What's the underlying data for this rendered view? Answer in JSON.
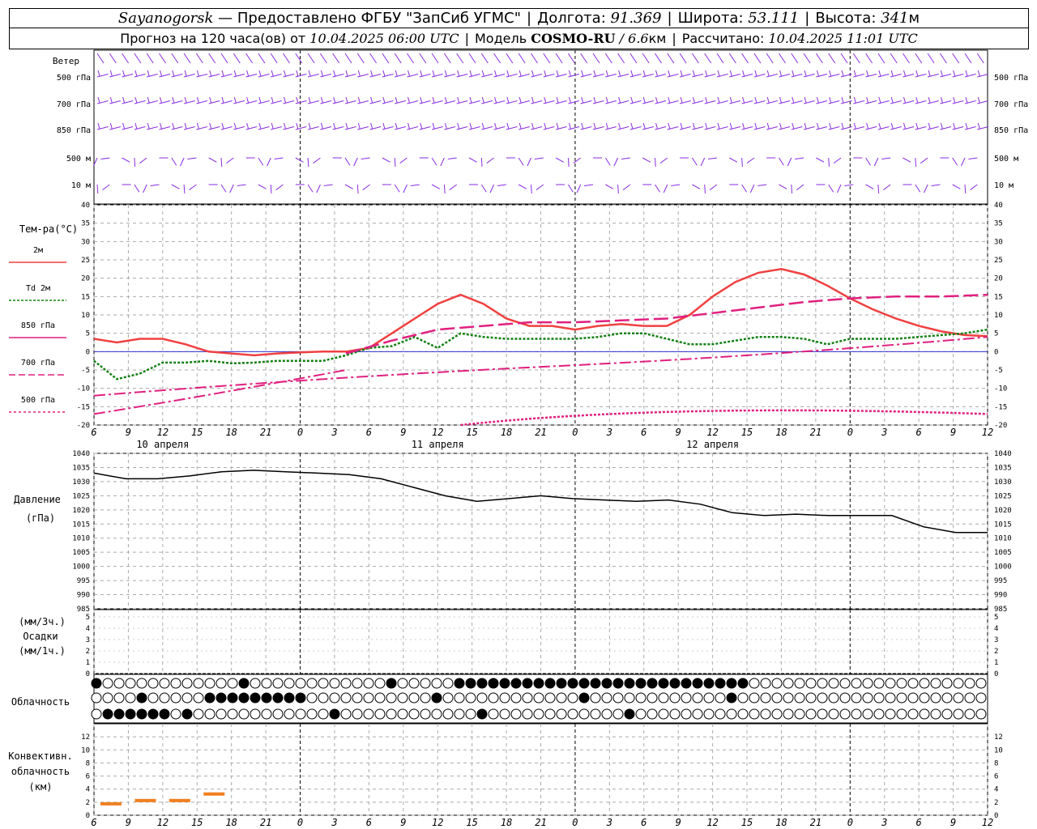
{
  "header": {
    "station": "Sayanogorsk",
    "provided_by": "— Предоставлено ФГБУ \"ЗапСиб УГМС\"",
    "lon_label": "Долгота:",
    "lon_value": "91.369",
    "lat_label": "Широта:",
    "lat_value": "53.111",
    "alt_label": "Высота:",
    "alt_value": "341",
    "alt_unit": "м",
    "forecast_prefix": "Прогноз на 120 часа(ов) от",
    "forecast_start": "10.04.2025 06:00 UTC",
    "model_label": "Модель",
    "model_name": "COSMO-RU",
    "model_res": "/ 6.6",
    "model_res_unit": "км",
    "computed_label": "Рассчитано:",
    "computed_time": "10.04.2025 11:01 UTC"
  },
  "wind_panel": {
    "title": "Ветер",
    "levels": [
      "500 гПа",
      "700 гПа",
      "850 гПа",
      "500 м",
      "10 м"
    ]
  },
  "temp_panel": {
    "title": "Тем-ра(°C)",
    "legend": [
      "2м",
      "Td 2м",
      "850 гПа",
      "700 гПа",
      "500 гПа"
    ],
    "y_ticks": [
      40,
      35,
      30,
      25,
      20,
      15,
      10,
      5,
      0,
      -5,
      -10,
      -15,
      -20
    ]
  },
  "time_axis": {
    "hour_labels": [
      "6",
      "9",
      "12",
      "15",
      "18",
      "21",
      "0",
      "3",
      "6",
      "9",
      "12",
      "15",
      "18",
      "21",
      "0",
      "3",
      "6",
      "9",
      "12",
      "15",
      "18",
      "21",
      "0",
      "3",
      "6",
      "9",
      "12"
    ],
    "dates": [
      "10 апреля",
      "11 апреля",
      "12 апреля"
    ]
  },
  "pressure_panel": {
    "title": "Давление",
    "unit": "(гПа)",
    "y_ticks": [
      1040,
      1035,
      1030,
      1025,
      1020,
      1015,
      1010,
      1005,
      1000,
      995,
      990,
      985
    ]
  },
  "precip_panel": {
    "unit_top": "(мм/3ч.)",
    "title": "Осадки",
    "unit_bottom": "(мм/1ч.)",
    "y_ticks": [
      5,
      4,
      3,
      2,
      1,
      0
    ]
  },
  "cloud_panel": {
    "title": "Облачность"
  },
  "conv_panel": {
    "title": [
      "Конвективн.",
      "облачность",
      "(км)"
    ],
    "y_ticks": [
      12,
      10,
      8,
      6,
      4,
      2,
      0
    ]
  },
  "colors": {
    "t2m": "#f04040",
    "td2m": "#138013",
    "t850": "#e0207f",
    "t700": "#e0207f",
    "t500": "#e0207f",
    "pressure": "#000000",
    "wind": "#8a2be2",
    "convective": "#f08020",
    "zero_line": "#3030d0"
  },
  "chart_data": {
    "type": "line",
    "x_hours_from_start": [
      0,
      3,
      6,
      9,
      12,
      15,
      18,
      21,
      24,
      27,
      30,
      33,
      36,
      39,
      42,
      45,
      48,
      51,
      54,
      57,
      60,
      63,
      66,
      69,
      72,
      75,
      78
    ],
    "xlim_hours": [
      0,
      78
    ],
    "series": [
      {
        "name": "2м",
        "units": "°C",
        "x": [
          0,
          2,
          4,
          6,
          8,
          10,
          12,
          14,
          16,
          18,
          20,
          22,
          24,
          26,
          28,
          30,
          32,
          34,
          36,
          38,
          40,
          42,
          44,
          46,
          48,
          50,
          52,
          54,
          56,
          58,
          60,
          62,
          64,
          66,
          68,
          70,
          72,
          74,
          76,
          78
        ],
        "y": [
          3.5,
          2.5,
          3.5,
          3.5,
          2,
          0,
          -0.5,
          -1,
          -0.5,
          -0.2,
          0,
          0,
          1,
          5,
          9,
          13,
          15.5,
          13,
          9,
          7,
          7,
          6,
          7,
          7.5,
          7,
          7,
          10,
          15,
          19,
          21.5,
          22.5,
          21,
          18,
          14.5,
          11.5,
          9,
          7,
          5.5,
          4.5,
          4.2
        ]
      },
      {
        "name": "Td 2м",
        "units": "°C",
        "x": [
          0,
          2,
          4,
          6,
          8,
          10,
          12,
          14,
          16,
          18,
          20,
          22,
          24,
          26,
          28,
          30,
          32,
          34,
          36,
          38,
          40,
          42,
          44,
          46,
          48,
          50,
          52,
          54,
          56,
          58,
          60,
          62,
          64,
          66,
          68,
          70,
          72,
          74,
          76,
          78
        ],
        "y": [
          -2.5,
          -7.5,
          -6,
          -3,
          -3,
          -2.5,
          -3.2,
          -3,
          -2.5,
          -2.5,
          -2.5,
          -1,
          1,
          1.5,
          4,
          1,
          5,
          4,
          3.5,
          3.5,
          3.5,
          3.5,
          4,
          5,
          5,
          3.5,
          2,
          2,
          3,
          4,
          4,
          3.5,
          2,
          3.5,
          3.5,
          3.5,
          4,
          4.5,
          5,
          6
        ]
      },
      {
        "name": "850 гПа",
        "units": "°C",
        "x": [
          22,
          26,
          30,
          34,
          38,
          42,
          46,
          50,
          54,
          58,
          62,
          66,
          70,
          74,
          78
        ],
        "y": [
          -0.5,
          3,
          6,
          7,
          8,
          8,
          8.5,
          9,
          10.5,
          12,
          13.5,
          14.5,
          15,
          15,
          15.5
        ]
      }
    ],
    "ylim_temp": [
      -20,
      40
    ],
    "pressure_hPa": {
      "x": [
        0,
        3,
        6,
        9,
        12,
        15,
        18,
        21,
        24,
        27,
        30,
        33,
        36,
        39,
        42,
        45,
        48,
        51,
        54,
        57,
        60,
        63,
        66,
        69,
        72,
        75,
        78
      ],
      "y": [
        1033,
        1031,
        1031,
        1032,
        1033.5,
        1034,
        1033.5,
        1033,
        1032.5,
        1031,
        1028,
        1025,
        1023,
        1024,
        1025,
        1024,
        1023.5,
        1023,
        1023.5,
        1022,
        1019,
        1018,
        1018.5,
        1018,
        1018,
        1018,
        1014,
        1012,
        1012
      ]
    },
    "ylim_pressure": [
      985,
      1040
    ],
    "convective_km": {
      "x": [
        0,
        3,
        6,
        9
      ],
      "y": [
        1.5,
        2,
        2,
        3
      ]
    },
    "ylim_convective": [
      0,
      12
    ]
  }
}
